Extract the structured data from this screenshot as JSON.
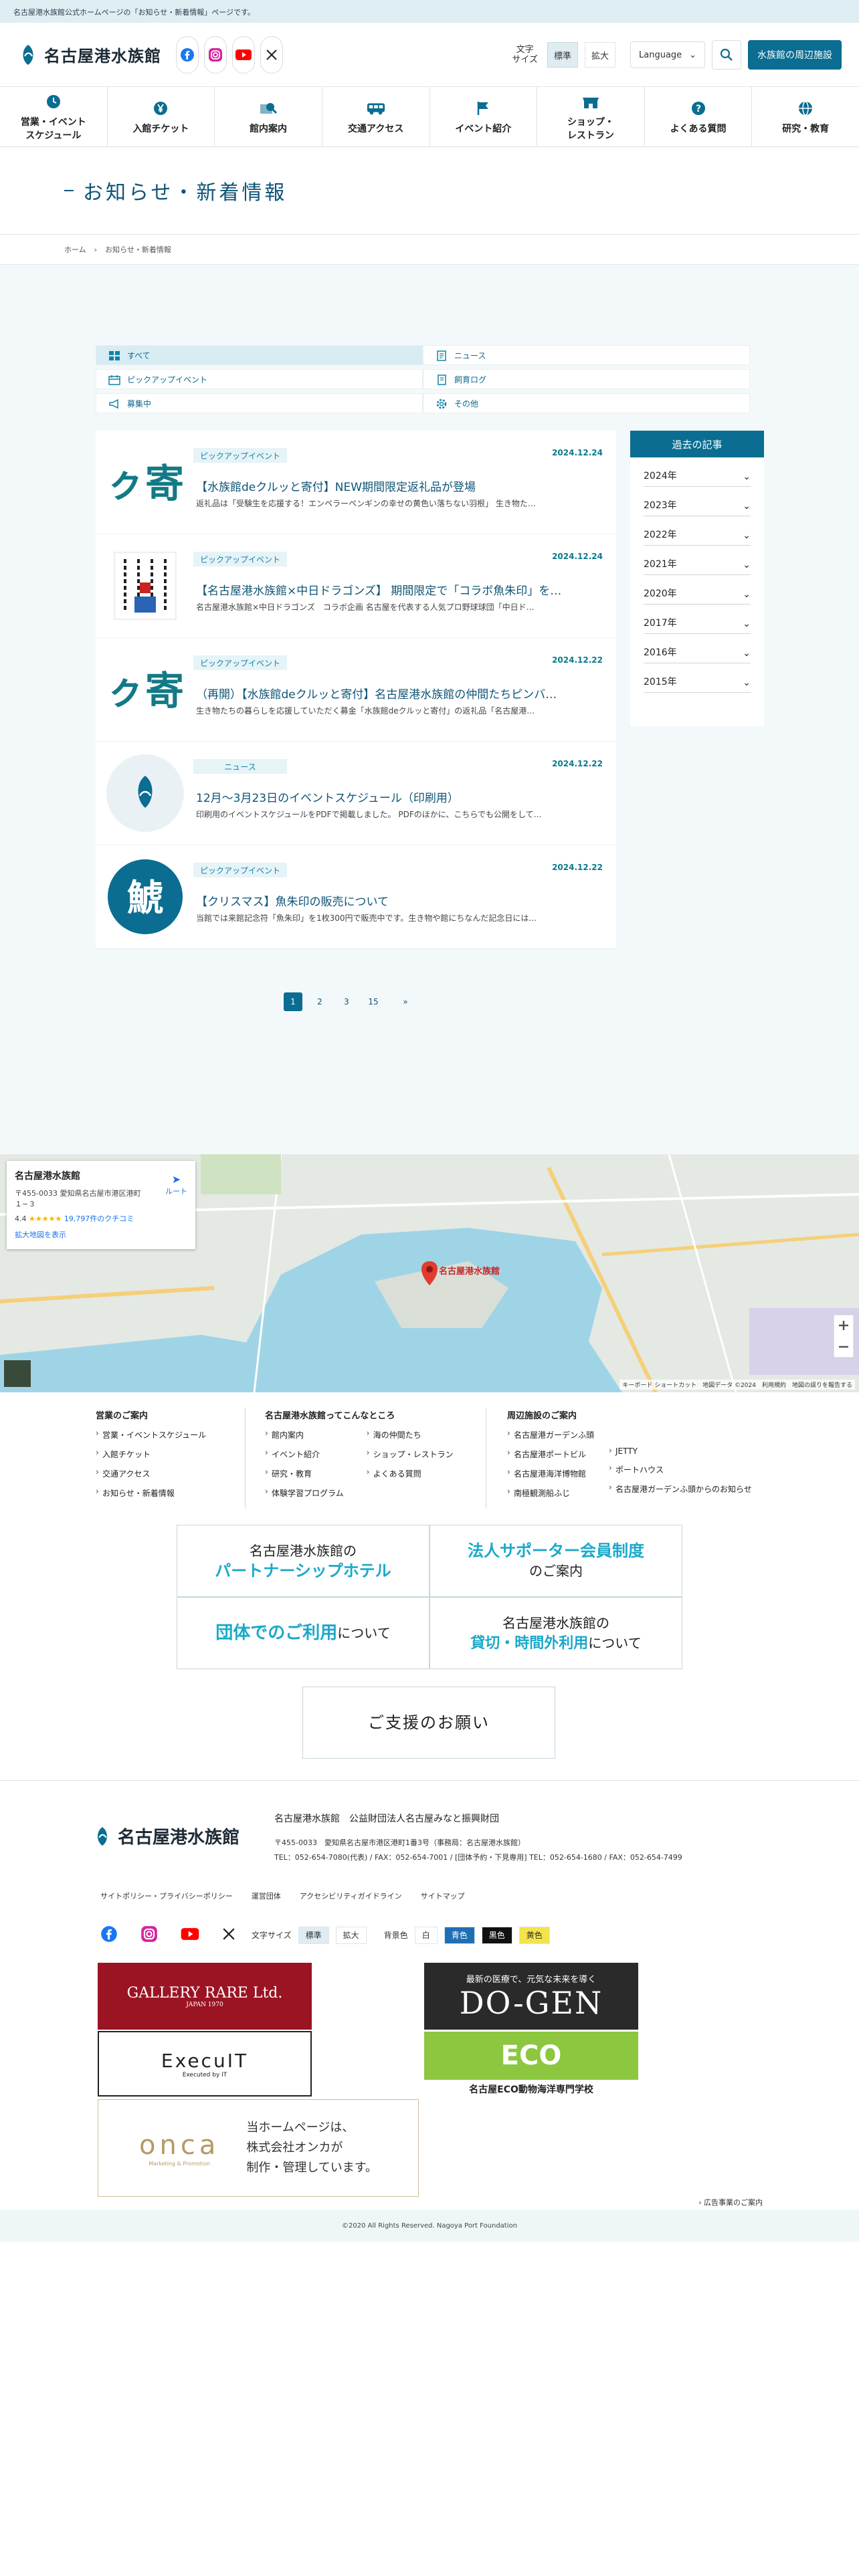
{
  "topbar": {
    "text": "名古屋港水族館公式ホームページの「お知らせ・新着情報」ページです。"
  },
  "header": {
    "logo": "名古屋港水族館",
    "fontsize_label": "文字\nサイズ",
    "fontsize_std": "標準",
    "fontsize_large": "拡大",
    "language": "Language",
    "surround": "水族館の周辺施設"
  },
  "nav": [
    {
      "label": "営業・イベント\nスケジュール",
      "icon": "clock-icon"
    },
    {
      "label": "入館チケット",
      "icon": "yen-icon"
    },
    {
      "label": "館内案内",
      "icon": "map-search-icon"
    },
    {
      "label": "交通アクセス",
      "icon": "bus-icon"
    },
    {
      "label": "イベント紹介",
      "icon": "flag-icon"
    },
    {
      "label": "ショップ・\nレストラン",
      "icon": "shop-icon"
    },
    {
      "label": "よくある質問",
      "icon": "question-icon"
    },
    {
      "label": "研究・教育",
      "icon": "globe-icon"
    }
  ],
  "page": {
    "title": "お知らせ・新着情報",
    "breadcrumb": [
      "ホーム",
      "お知らせ・新着情報"
    ]
  },
  "tabs": [
    {
      "label": "すべて",
      "icon": "grid-icon"
    },
    {
      "label": "ニュース",
      "icon": "news-icon"
    },
    {
      "label": "ピックアップイベント",
      "icon": "calendar-icon"
    },
    {
      "label": "飼育ログ",
      "icon": "log-icon"
    },
    {
      "label": "募集中",
      "icon": "megaphone-icon"
    },
    {
      "label": "その他",
      "icon": "gear-icon"
    }
  ],
  "news": [
    {
      "category": "ピックアップイベント",
      "date": "2024.12.24",
      "title": "【水族館deクルッと寄付】NEW期間限定返礼品が登場",
      "desc": "返礼品は「受験生を応援する！エンペラーペンギンの幸せの黄色い落ちない羽根」 生き物た…",
      "thumb": "kuruto"
    },
    {
      "category": "ピックアップイベント",
      "date": "2024.12.24",
      "title": "【名古屋港水族館×中日ドラゴンズ】 期間限定で「コラボ魚朱印」を…",
      "desc": "名古屋港水族館×中日ドラゴンズ　コラボ企画 名古屋を代表する人気プロ野球球団「中日ド…",
      "thumb": "goshuin"
    },
    {
      "category": "ピックアップイベント",
      "date": "2024.12.22",
      "title": "（再開）【水族館deクルッと寄付】名古屋港水族館の仲間たちピンバ…",
      "desc": "生き物たちの暮らしを応援していただく募金「水族館deクルッと寄付」の返礼品「名古屋港…",
      "thumb": "kuruto"
    },
    {
      "category": "ニュース",
      "date": "2024.12.22",
      "title": "12月～3月23日のイベントスケジュール（印刷用）",
      "desc": "印刷用のイベントスケジュールをPDFで掲載しました。 PDFのほかに、こちらでも公開をして…",
      "thumb": "logo"
    },
    {
      "category": "ピックアップイベント",
      "date": "2024.12.22",
      "title": "【クリスマス】魚朱印の販売について",
      "desc": "当館では来館記念符「魚朱印」を1枚300円で販売中です。生き物や館にちなんだ記念日には…",
      "thumb": "gyoshuin"
    }
  ],
  "archive": {
    "title": "過去の記事",
    "years": [
      "2024年",
      "2023年",
      "2022年",
      "2021年",
      "2020年",
      "2017年",
      "2016年",
      "2015年"
    ]
  },
  "pager": [
    "1",
    "2",
    "3",
    "15",
    "»"
  ],
  "map": {
    "name": "名古屋港水族館",
    "address": "〒455-0033 愛知県名古屋市港区港町\n１−３",
    "rating": "4.4",
    "stars": "★★★★★",
    "reviews": "19,797件のクチコミ",
    "enlarge": "拡大地図を表示",
    "route": "ルート",
    "pin_label": "名古屋港水族館",
    "attrib": "キーボード ショートカット　地図データ ©2024　利用規約　地図の誤りを報告する"
  },
  "footer_links": {
    "col1": {
      "title": "営業のご案内",
      "links": [
        "営業・イベントスケジュール",
        "入館チケット",
        "交通アクセス",
        "お知らせ・新着情報"
      ]
    },
    "col2": {
      "title": "名古屋港水族館ってこんなところ",
      "links_a": [
        "館内案内",
        "イベント紹介",
        "研究・教育",
        "体験学習プログラム"
      ],
      "links_b": [
        "海の仲間たち",
        "ショップ・レストラン",
        "よくある質問"
      ]
    },
    "col3": {
      "title": "周辺施設のご案内",
      "links_a": [
        "名古屋港ガーデンふ頭",
        "名古屋港ポートビル",
        "名古屋港海洋博物館",
        "南極観測船ふじ"
      ],
      "links_b": [
        "JETTY",
        "ポートハウス",
        "名古屋港ガーデンふ頭からのお知らせ"
      ]
    }
  },
  "banners": {
    "partner": {
      "line1": "名古屋港水族館の",
      "line2": "パートナーシップホテル"
    },
    "supporter": {
      "line1": "法人サポーター会員制度",
      "line2": "のご案内"
    },
    "group": {
      "accent": "団体でのご利用",
      "rest": "について"
    },
    "rental": {
      "line1": "名古屋港水族館の",
      "accent": "貸切・時間外利用",
      "rest": "について"
    },
    "support": "ご支援のお願い"
  },
  "footer": {
    "logo": "名古屋港水族館",
    "org": "名古屋港水族館　公益財団法人名古屋みなと振興財団",
    "addr1": "〒455-0033　愛知県名古屋市港区港町1番3号（事務局：名古屋港水族館）",
    "addr2": "TEL：052-654-7080(代表) / FAX：052-654-7001 / [団体予約・下見専用] TEL：052-654-1680 / FAX：052-654-7499",
    "util": [
      "サイトポリシー・プライバシーポリシー",
      "運営団体",
      "アクセシビリティガイドライン",
      "サイトマップ"
    ],
    "fontsize": "文字サイズ",
    "std": "標準",
    "large": "拡大",
    "bg": "背景色",
    "bg_white": "白",
    "bg_blue": "青色",
    "bg_black": "黒色",
    "bg_yellow": "黄色",
    "sponsors": {
      "gallery": "GALLERY RARE Ltd.",
      "gallery_sub": "JAPAN 1970",
      "execuit": "ExecuIT",
      "execuit_sub": "Executed by IT",
      "dogen_sub": "最新の医療で、元気な未来を導く",
      "dogen": "DO-GEN",
      "eco": "名古屋ECO動物海洋専門学校",
      "eco_mark": "ECO",
      "onca": "onca",
      "onca_sub": "Marketing & Promotion",
      "onca_msg": "当ホームページは、\n株式会社オンカが\n制作・管理しています。"
    },
    "ad": "広告事業のご案内",
    "copyright": "©2020 All Rights Reserved. Nagoya Port Foundation"
  }
}
